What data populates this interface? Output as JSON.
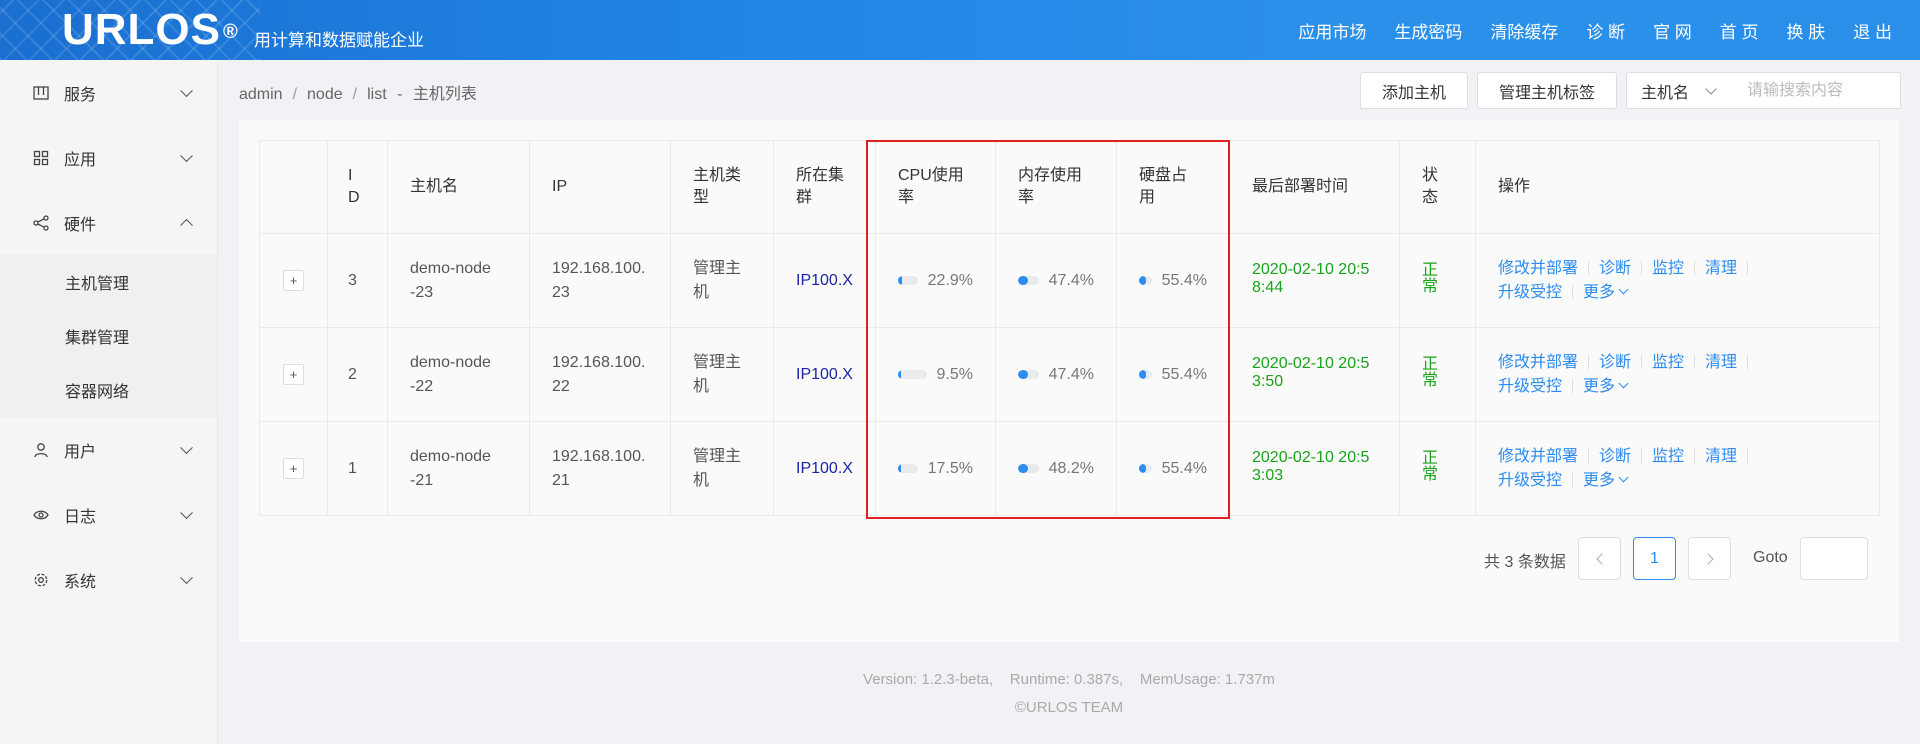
{
  "header": {
    "logo": "URLOS",
    "logo_mark": "®",
    "slogan": "用计算和数据赋能企业",
    "nav": [
      "应用市场",
      "生成密码",
      "清除缓存",
      "诊 断",
      "官 网",
      "首 页",
      "换 肤",
      "退 出"
    ]
  },
  "sidebar": {
    "menu_service": "服务",
    "menu_app": "应用",
    "menu_hardware": "硬件",
    "sub_host": "主机管理",
    "sub_cluster": "集群管理",
    "sub_network": "容器网络",
    "menu_user": "用户",
    "menu_log": "日志",
    "menu_system": "系统"
  },
  "breadcrumb": {
    "a": "admin",
    "b": "node",
    "c": "list",
    "dash": "-",
    "title": "主机列表"
  },
  "toolbar": {
    "add_host": "添加主机",
    "manage_tags": "管理主机标签",
    "search_field": "主机名",
    "search_placeholder": "请输搜索内容"
  },
  "table": {
    "headers": {
      "id": "I D",
      "name": "主机名",
      "ip": "IP",
      "type": "主机类型",
      "cluster": "所在集群",
      "cpu": "CPU使用率",
      "mem": "内存使用率",
      "disk": "硬盘占用",
      "deploy": "最后部署时间",
      "status": "状态",
      "ops": "操作"
    },
    "rows": [
      {
        "id": "3",
        "name": "demo-node-23",
        "ip": "192.168.100.23",
        "type": "管理主机",
        "cluster": "IP100.X",
        "cpu": 22.9,
        "cpu_text": "22.9%",
        "mem": 47.4,
        "mem_text": "47.4%",
        "disk": 55.4,
        "disk_text": "55.4%",
        "deploy": "2020-02-10 20:58:44",
        "status": "正常"
      },
      {
        "id": "2",
        "name": "demo-node-22",
        "ip": "192.168.100.22",
        "type": "管理主机",
        "cluster": "IP100.X",
        "cpu": 9.5,
        "cpu_text": "9.5%",
        "mem": 47.4,
        "mem_text": "47.4%",
        "disk": 55.4,
        "disk_text": "55.4%",
        "deploy": "2020-02-10 20:53:50",
        "status": "正常"
      },
      {
        "id": "1",
        "name": "demo-node-21",
        "ip": "192.168.100.21",
        "type": "管理主机",
        "cluster": "IP100.X",
        "cpu": 17.5,
        "cpu_text": "17.5%",
        "mem": 48.2,
        "mem_text": "48.2%",
        "disk": 55.4,
        "disk_text": "55.4%",
        "deploy": "2020-02-10 20:53:03",
        "status": "正常"
      }
    ],
    "ops": {
      "modify": "修改并部署",
      "diagnose": "诊断",
      "monitor": "监控",
      "clean": "清理",
      "upgrade": "升级受控",
      "more": "更多"
    },
    "expand_symbol": "+"
  },
  "pagination": {
    "total_prefix": "共",
    "total_count": "3",
    "total_suffix": "条数据",
    "current_page": "1",
    "goto_label": "Goto"
  },
  "footer": {
    "line1": "Version: 1.2.3-beta,    Runtime: 0.387s,    MemUsage: 1.737m",
    "line2": "©URLOS TEAM"
  },
  "colors": {
    "header": "#2186e6",
    "accent": "#2d8cf0",
    "status_ok": "#19a21b",
    "highlight": "#e02020"
  }
}
